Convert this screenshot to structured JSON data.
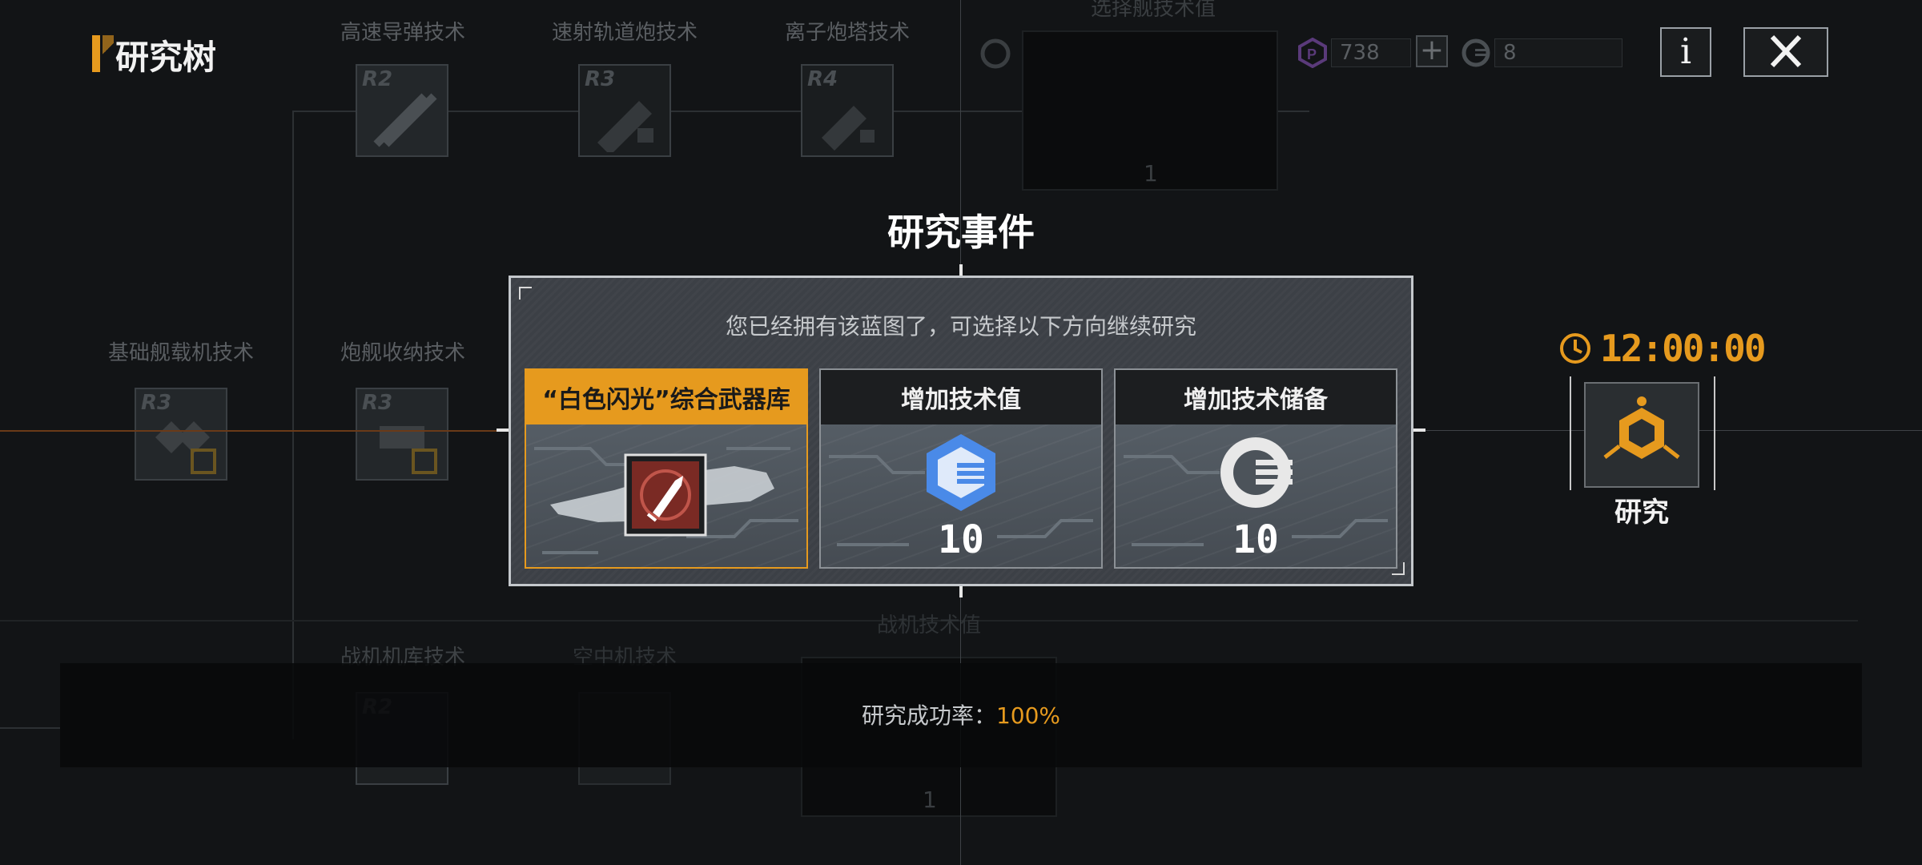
{
  "header": {
    "title": "研究树"
  },
  "currency": {
    "premium": "738",
    "tech_points": "8"
  },
  "buttons": {
    "info_label": "i"
  },
  "tree_nodes": [
    {
      "title": "高速导弹技术",
      "rank": "R2"
    },
    {
      "title": "速射轨道炮技术",
      "rank": "R3"
    },
    {
      "title": "离子炮塔技术",
      "rank": "R4"
    },
    {
      "title": "选择舰技术值",
      "rank": ""
    },
    {
      "title": "基础舰载机技术",
      "rank": "R3"
    },
    {
      "title": "炮舰收纳技术",
      "rank": "R3"
    },
    {
      "title": "战机机库技术",
      "rank": "R2"
    },
    {
      "title": "空中机技术",
      "rank": ""
    },
    {
      "title": "战机技术值",
      "rank": ""
    }
  ],
  "dark_box_counts": [
    "1",
    "1"
  ],
  "modal": {
    "title": "研究事件",
    "subtitle": "您已经拥有该蓝图了，可选择以下方向继续研究",
    "options": [
      {
        "label": "“白色闪光”综合武器库",
        "value": "",
        "icon": "blueprint-weapon-icon",
        "selected": true
      },
      {
        "label": "增加技术值",
        "value": "10",
        "icon": "tech-value-icon",
        "selected": false
      },
      {
        "label": "增加技术储备",
        "value": "10",
        "icon": "tech-reserve-icon",
        "selected": false
      }
    ]
  },
  "research": {
    "timer": "12:00:00",
    "label": "研究"
  },
  "footer": {
    "success_label": "研究成功率：",
    "success_value": "100%"
  },
  "colors": {
    "accent": "#e69a1e",
    "background": "#121416",
    "modal": "#3c4046",
    "tech_blue": "#4a8ae8"
  }
}
